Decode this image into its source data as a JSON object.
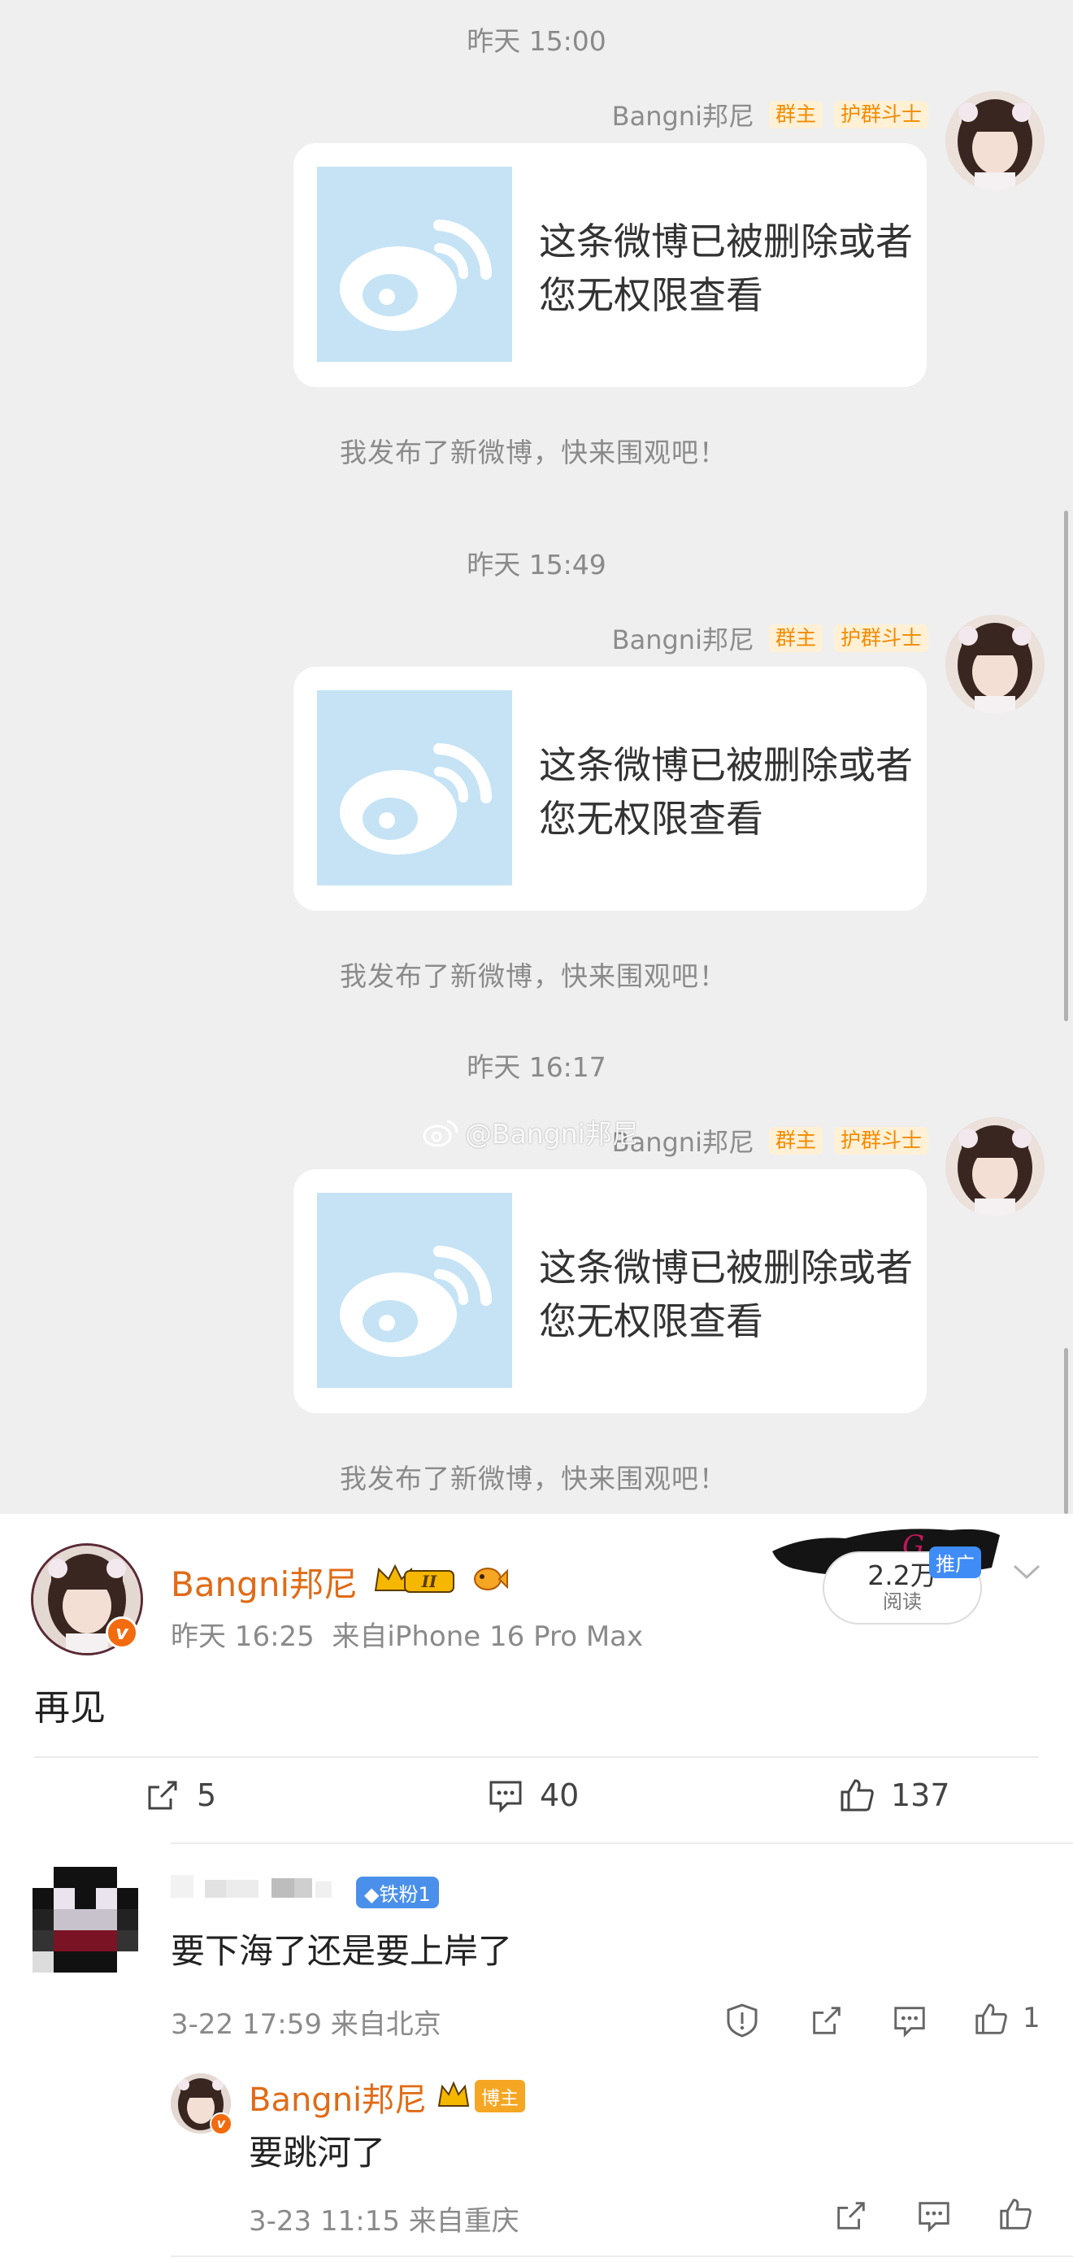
{
  "chat": {
    "messages": [
      {
        "time": "昨天 15:00",
        "sender": "Bangni邦尼",
        "tags": [
          "群主",
          "护群斗士"
        ],
        "card_text": "这条微博已被删除或者您无权限查看",
        "system_text": "我发布了新微博，快来围观吧！"
      },
      {
        "time": "昨天 15:49",
        "sender": "Bangni邦尼",
        "tags": [
          "群主",
          "护群斗士"
        ],
        "card_text": "这条微博已被删除或者您无权限查看",
        "system_text": "我发布了新微博，快来围观吧！"
      },
      {
        "time": "昨天 16:17",
        "sender": "Bangni邦尼",
        "tags": [
          "群主",
          "护群斗士"
        ],
        "card_text": "这条微博已被删除或者您无权限查看",
        "system_text": "我发布了新微博，快来围观吧！"
      }
    ],
    "watermark": "@Bangni邦尼"
  },
  "post": {
    "author": "Bangni邦尼",
    "time": "昨天 16:25",
    "source": "来自iPhone 16 Pro Max",
    "text": "再见",
    "promo_views": "2.2万",
    "promo_views_label": "阅读",
    "promo_tag": "推广",
    "repost_count": "5",
    "comment_count": "40",
    "like_count": "137"
  },
  "comments": [
    {
      "text": "要下海了还是要上岸了",
      "fan_badge": "铁粉1",
      "meta": "3-22 17:59 来自北京",
      "likes": "1",
      "reply": {
        "author": "Bangni邦尼",
        "badge": "博主",
        "text": "要跳河了",
        "meta": "3-23 11:15 来自重庆"
      }
    }
  ],
  "colors": {
    "accent_orange": "#e06b17",
    "chat_bg": "#efefef",
    "thumb_blue": "#c5e3f5",
    "fan_blue": "#4a90ea"
  },
  "icons": [
    "weibo-logo-icon",
    "crown-icon",
    "fish-icon",
    "chevron-down-icon",
    "repost-icon",
    "comment-icon",
    "like-icon",
    "report-icon",
    "share-icon"
  ]
}
